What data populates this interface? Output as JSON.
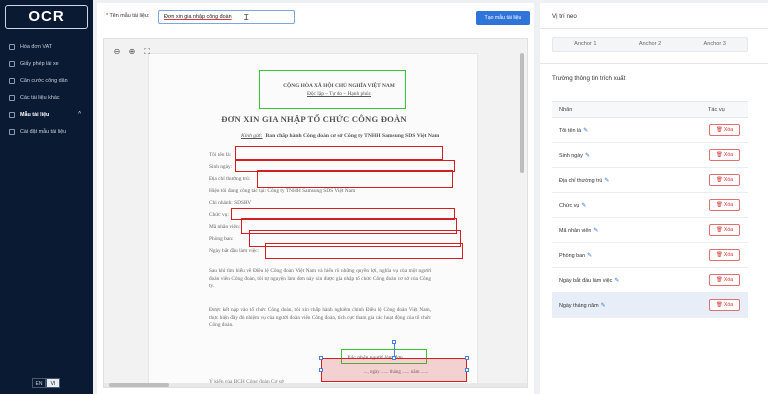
{
  "app": {
    "logo": "OCR"
  },
  "sidebar": {
    "items": [
      {
        "label": "Hóa đơn VAT"
      },
      {
        "label": "Giấy phép lái xe"
      },
      {
        "label": "Căn cước công dân"
      },
      {
        "label": "Các tài liệu khác"
      }
    ],
    "group": {
      "label": "Mẫu tài liệu",
      "chevron": "^"
    },
    "sub_items": [
      {
        "label": "Cài đặt mẫu tài liệu"
      }
    ],
    "lang": {
      "en": "EN",
      "vi": "VI",
      "selected": "VI"
    }
  },
  "editor": {
    "name_label_star": "*",
    "name_label": "Tên mẫu tài liệu:",
    "name_value": "Đơn xin gia nhập công đoàn",
    "create_button": "Tạo mẫu tài liệu",
    "tools": {
      "zoom_out": "⊖",
      "zoom_in": "⊕",
      "fit": "⛶"
    }
  },
  "document": {
    "header_line1": "CỘNG HÒA XÃ HỘI CHỦ NGHĨA VIỆT NAM",
    "header_line2": "Độc lập – Tự do – Hạnh phúc",
    "title": "ĐƠN XIN GIA NHẬP TỔ CHỨC CÔNG ĐOÀN",
    "kinh_gui_label": "Kính gửi:",
    "kinh_gui_value": "Ban chấp hành Công đoàn cơ sở Công ty TNHH Samsung SDS Việt Nam",
    "fields": [
      "Tôi tên là:",
      "Sinh ngày:",
      "Địa chỉ thường trú:",
      "Hiện tôi đang công tác tại: Công ty TNHH Samsung SDS Việt Nam",
      "Chi nhánh: SDSRV",
      "Chức vụ:",
      "Mã nhân viên:",
      "Phòng ban:",
      "Ngày bắt đầu làm việc:"
    ],
    "para1": "Sau khi tìm hiểu về Điều lệ Công đoàn Việt Nam và hiểu rõ những quyền lợi, nghĩa vụ của một người đoàn viên Công đoàn, tôi tự nguyện làm đơn này xin được gia nhập tổ chức Công đoàn cơ sở của Công ty.",
    "para2": "Được kết nạp vào tổ chức Công đoàn, tôi xin chấp hành nghiêm chỉnh Điều lệ Công đoàn Việt Nam, thực hiện đầy đủ nhiệm vụ của người đoàn viên Công đoàn, tích cực tham gia các hoạt động của tổ chức Công đoàn.",
    "signature": "Xác nhận người làm đơn",
    "date_line": "..., ngày ...... tháng ...... năm ......",
    "footer": "Ý kiến của BCH Công đoàn Cơ sở"
  },
  "anchor_panel": {
    "title": "Vị trí neo",
    "tabs": [
      "Anchor 1",
      "Anchor 2",
      "Anchor 3"
    ]
  },
  "fields_panel": {
    "title": "Trường thông tin trích xuất",
    "col_label": "Nhãn",
    "col_action": "Tác vụ",
    "delete_label": "Xóa",
    "rows": [
      {
        "label": "Tôi tên là"
      },
      {
        "label": "Sinh ngày"
      },
      {
        "label": "Địa chỉ thường trú"
      },
      {
        "label": "Chức vụ"
      },
      {
        "label": "Mã nhân viên"
      },
      {
        "label": "Phòng ban"
      },
      {
        "label": "Ngày bắt đầu làm việc"
      },
      {
        "label": "Ngày tháng năm"
      }
    ],
    "highlighted_row": "Ngày tháng năm"
  },
  "colors": {
    "sidebar": "#0b1a33",
    "primary": "#2e74d9",
    "field_box": "#d31f1f",
    "anchor_box": "#33c733",
    "danger": "#d32f2f"
  }
}
